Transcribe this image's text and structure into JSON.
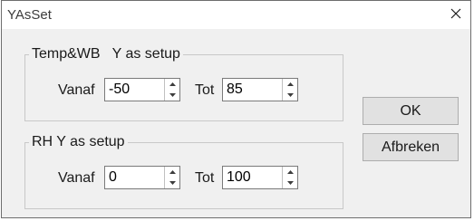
{
  "window": {
    "title": "YAsSet",
    "close_icon": "close-icon"
  },
  "temp_group": {
    "caption": "Temp&WB   Y as setup",
    "from_label": "Vanaf",
    "from_value": "-50",
    "to_label": "Tot",
    "to_value": "85"
  },
  "rh_group": {
    "caption": "RH Y as setup",
    "from_label": "Vanaf",
    "from_value": "0",
    "to_label": "Tot",
    "to_value": "100"
  },
  "buttons": {
    "ok_label": "OK",
    "cancel_label": "Afbreken"
  }
}
